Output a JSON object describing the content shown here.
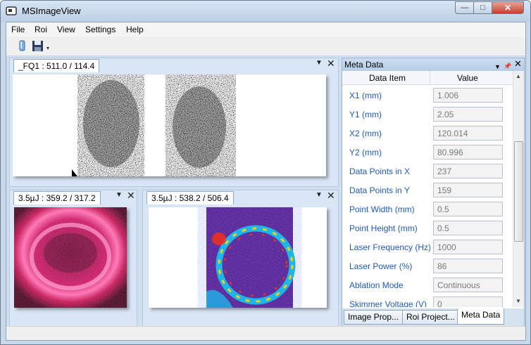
{
  "window": {
    "title": "MSImageView",
    "minimize_glyph": "—",
    "maximize_glyph": "□",
    "close_glyph": "✕"
  },
  "menu": [
    "File",
    "Roi",
    "View",
    "Settings",
    "Help"
  ],
  "toolbar": {
    "icons": [
      "open-file-icon",
      "save-icon",
      "toolbar-overflow-icon"
    ]
  },
  "panes": {
    "top": {
      "tab": "_FQ1 : 511.0 / 114.4"
    },
    "bottom_left": {
      "tab": "3.5µJ : 359.2 / 317.2"
    },
    "bottom_right": {
      "tab": "3.5µJ : 538.2 / 506.4"
    },
    "dropdown_glyph": "▼",
    "close_glyph": "✕"
  },
  "meta": {
    "title": "Meta Data",
    "dropdown_glyph": "▼",
    "pin_glyph": "📌",
    "close_glyph": "✕",
    "header": {
      "item": "Data Item",
      "value": "Value"
    },
    "rows": [
      {
        "name": "X1 (mm)",
        "value": "1.006"
      },
      {
        "name": "Y1 (mm)",
        "value": "2.05"
      },
      {
        "name": "X2 (mm)",
        "value": "120.014"
      },
      {
        "name": "Y2 (mm)",
        "value": "80.996"
      },
      {
        "name": "Data Points in X",
        "value": "237"
      },
      {
        "name": "Data Points in Y",
        "value": "159"
      },
      {
        "name": "Point Width (mm)",
        "value": "0.5"
      },
      {
        "name": "Point Height (mm)",
        "value": "0.5"
      },
      {
        "name": "Laser Frequency (Hz)",
        "value": "1000"
      },
      {
        "name": "Laser Power (%)",
        "value": "86"
      },
      {
        "name": "Ablation Mode",
        "value": "Continuous"
      },
      {
        "name": "Skimmer Voltage (V)",
        "value": "0"
      }
    ],
    "scroll_up_glyph": "▲",
    "scroll_down_glyph": "▼"
  },
  "bottom_tabs": [
    {
      "label": "Image Prop..."
    },
    {
      "label": "Roi Project..."
    },
    {
      "label": "Meta Data"
    }
  ],
  "colors": {
    "accent": "#1f5ab8",
    "title_bg": "#bcd0e6",
    "close": "#c6402b"
  }
}
